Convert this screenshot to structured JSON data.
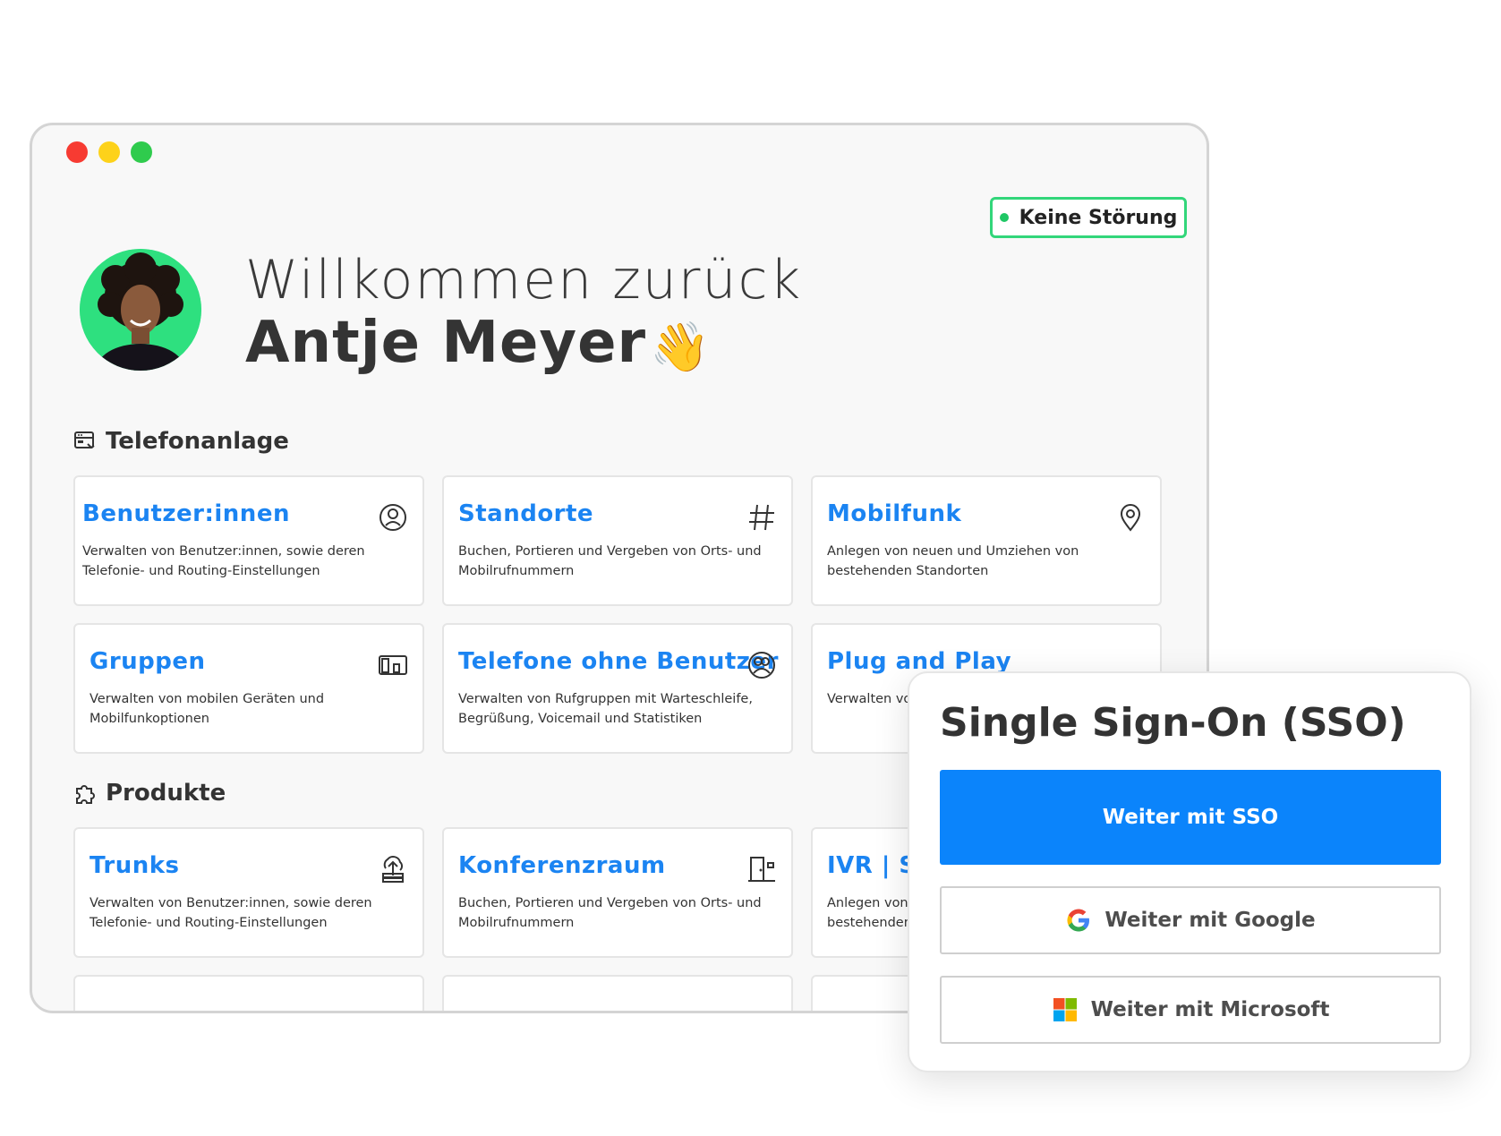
{
  "status": {
    "label": "Keine Störung",
    "color": "#1fc765"
  },
  "welcome": {
    "greeting": "Willkommen zurück",
    "name": "Antje Meyer",
    "emoji": "👋"
  },
  "sections": {
    "telefonanlage": {
      "title": "Telefonanlage",
      "icon": "server-phone-icon"
    },
    "produkte": {
      "title": "Produkte",
      "icon": "puzzle-icon"
    }
  },
  "cards": [
    {
      "title": "Benutzer:innen",
      "desc": "Verwalten von Benutzer:innen, sowie deren Telefonie- und Routing-Einstellungen",
      "icon": "user-circle-icon"
    },
    {
      "title": "Standorte",
      "desc": "Buchen, Portieren und Vergeben von Orts- und Mobilrufnummern",
      "icon": "hash-icon"
    },
    {
      "title": "Mobilfunk",
      "desc": "Anlegen von neuen und Umziehen von bestehenden Standorten",
      "icon": "location-pin-icon"
    },
    {
      "title": "Gruppen",
      "desc": "Verwalten von mobilen Geräten und Mobilfunkoptionen",
      "icon": "devices-icon"
    },
    {
      "title": "Telefone ohne Benutzer",
      "desc": "Verwalten von Rufgruppen mit Warteschleife, Begrüßung, Voicemail und Statistiken",
      "icon": "group-circle-icon"
    },
    {
      "title": "Plug and Play",
      "desc": "Verwalten von Telefonen",
      "icon": "plug-icon"
    },
    {
      "title": "Trunks",
      "desc": "Verwalten von Benutzer:innen, sowie deren Telefonie- und Routing-Einstellungen",
      "icon": "cloud-upload-icon"
    },
    {
      "title": "Konferenzraum",
      "desc": "Buchen, Portieren und Vergeben von Orts- und Mobilrufnummern",
      "icon": "door-icon"
    },
    {
      "title": "IVR | Sprachmenü",
      "desc": "Anlegen von neuen und Umziehen von bestehenden Standorten",
      "icon": "ivr-icon"
    }
  ],
  "sso": {
    "title": "Single Sign-On (SSO)",
    "sso_button": "Weiter mit SSO",
    "google_button": "Weiter mit Google",
    "microsoft_button": "Weiter mit Microsoft",
    "accent": "#0b84fb"
  },
  "window_controls": {
    "close": "#f73b32",
    "minimize": "#fdd21a",
    "maximize": "#2fcb4d"
  }
}
